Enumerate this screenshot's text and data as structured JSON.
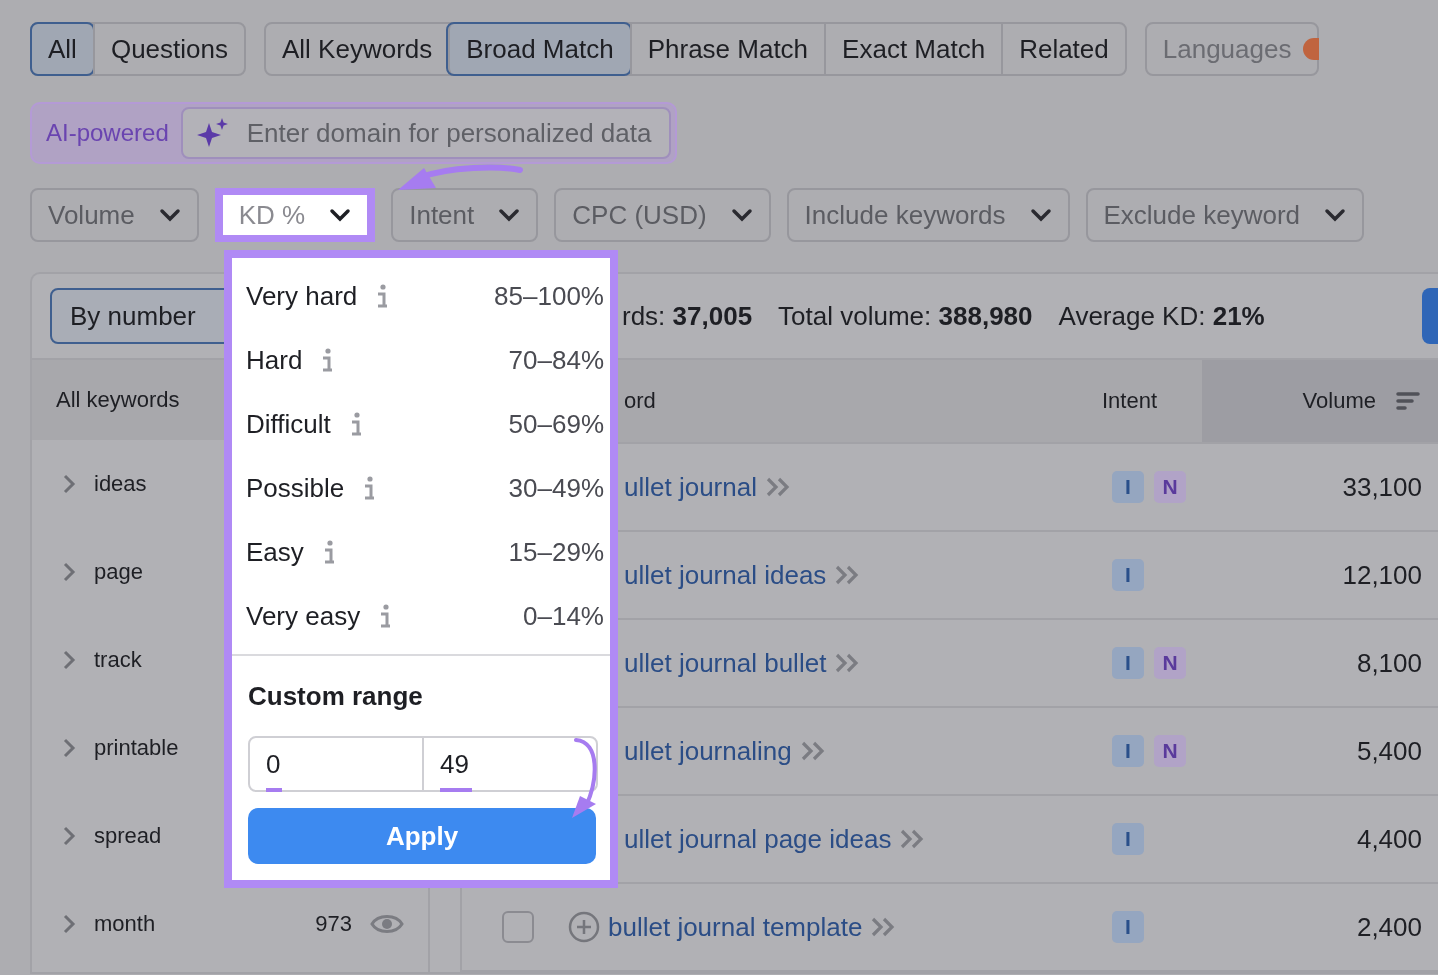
{
  "type_tabs": [
    {
      "label": "All",
      "selected": true
    },
    {
      "label": "Questions",
      "selected": false
    }
  ],
  "match_tabs": [
    {
      "label": "All Keywords",
      "selected": false
    },
    {
      "label": "Broad Match",
      "selected": true
    },
    {
      "label": "Phrase Match",
      "selected": false
    },
    {
      "label": "Exact Match",
      "selected": false
    },
    {
      "label": "Related",
      "selected": false
    }
  ],
  "languages": {
    "label": "Languages"
  },
  "ai": {
    "badge": "AI-powered",
    "placeholder": "Enter domain for personalized data"
  },
  "filters": [
    {
      "label": "Volume",
      "highlighted": false
    },
    {
      "label": "KD %",
      "highlighted": true
    },
    {
      "label": "Intent",
      "highlighted": false
    },
    {
      "label": "CPC (USD)",
      "highlighted": false
    },
    {
      "label": "Include keywords",
      "highlighted": false
    },
    {
      "label": "Exclude keyword",
      "highlighted": false
    }
  ],
  "toolbar": {
    "group_button": "By number",
    "stats": [
      {
        "label": "rds:",
        "value": "37,005"
      },
      {
        "label": "Total volume:",
        "value": "388,980"
      },
      {
        "label": "Average KD:",
        "value": "21%"
      }
    ]
  },
  "sidebar": {
    "header": "All keywords",
    "items": [
      {
        "label": "ideas"
      },
      {
        "label": "page"
      },
      {
        "label": "track"
      },
      {
        "label": "printable"
      },
      {
        "label": "spread"
      },
      {
        "label": "month",
        "count": "973"
      }
    ]
  },
  "table": {
    "columns": [
      "ord",
      "Intent",
      "Volume"
    ],
    "rows": [
      {
        "kind": "covered",
        "keyword": "ullet journal",
        "intents": [
          {
            "label": "I",
            "kind": "informational"
          },
          {
            "label": "N",
            "kind": "navigational"
          }
        ],
        "volume": "33,100"
      },
      {
        "kind": "covered",
        "keyword": "ullet journal ideas",
        "intents": [
          {
            "label": "I",
            "kind": "informational"
          }
        ],
        "volume": "12,100"
      },
      {
        "kind": "covered",
        "keyword": "ullet journal bullet",
        "intents": [
          {
            "label": "I",
            "kind": "informational"
          },
          {
            "label": "N",
            "kind": "navigational"
          }
        ],
        "volume": "8,100"
      },
      {
        "kind": "covered",
        "keyword": "ullet journaling",
        "intents": [
          {
            "label": "I",
            "kind": "informational"
          },
          {
            "label": "N",
            "kind": "navigational"
          }
        ],
        "volume": "5,400"
      },
      {
        "kind": "covered",
        "keyword": "ullet journal page ideas",
        "intents": [
          {
            "label": "I",
            "kind": "informational"
          }
        ],
        "volume": "4,400"
      },
      {
        "kind": "full",
        "checked": false,
        "keyword": "bullet journal template",
        "intents": [
          {
            "label": "I",
            "kind": "informational"
          }
        ],
        "volume": "2,400"
      }
    ]
  },
  "kd_dropdown": {
    "options": [
      {
        "label": "Very hard",
        "range": "85–100%"
      },
      {
        "label": "Hard",
        "range": "70–84%"
      },
      {
        "label": "Difficult",
        "range": "50–69%"
      },
      {
        "label": "Possible",
        "range": "30–49%"
      },
      {
        "label": "Easy",
        "range": "15–29%"
      },
      {
        "label": "Very easy",
        "range": "0–14%"
      }
    ],
    "custom_title": "Custom range",
    "from": "0",
    "to": "49",
    "apply": "Apply"
  }
}
